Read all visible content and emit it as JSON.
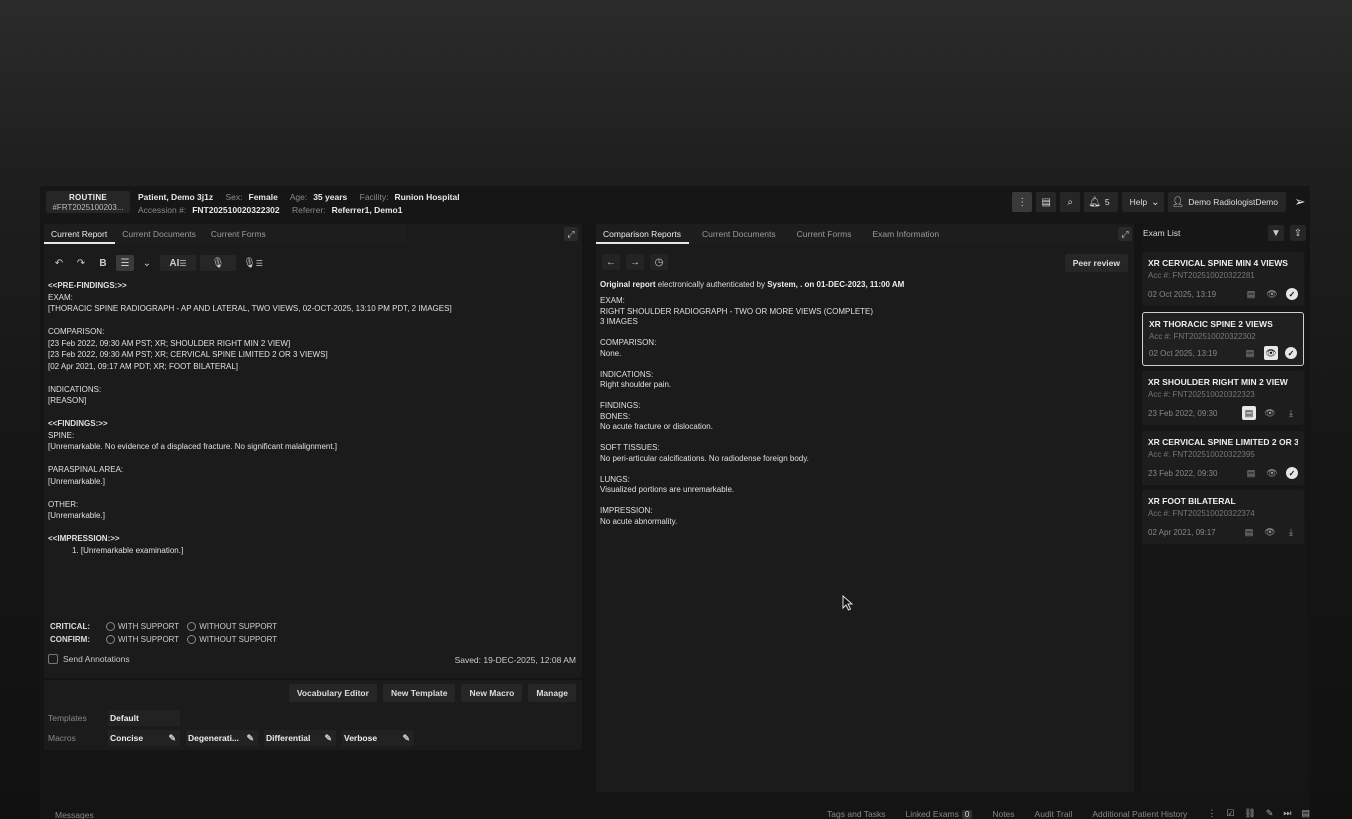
{
  "header": {
    "priority": "ROUTINE",
    "accession_short": "#FRT2025100203...",
    "patient_name": "Patient, Demo 3j1z",
    "sex_label": "Sex:",
    "sex": "Female",
    "age_label": "Age:",
    "age": "35 years",
    "facility_label": "Facility:",
    "facility": "Runion Hospital",
    "accession_label": "Accession #:",
    "accession": "FNT202510020322302",
    "referrer_label": "Referrer:",
    "referrer": "Referrer1, Demo1",
    "notifications_count": "5",
    "help_label": "Help",
    "user_name": "Demo RadiologistDemo"
  },
  "left_tabs": [
    "Current Report",
    "Current Documents",
    "Current Forms"
  ],
  "mid_tabs": [
    "Comparison Reports",
    "Current Documents",
    "Current Forms",
    "Exam Information"
  ],
  "toolbar": {
    "ai_label": "AI"
  },
  "report_lines": [
    {
      "t": "<<PRE-FINDINGS:>>",
      "b": true
    },
    {
      "t": "EXAM:"
    },
    {
      "t": "[THORACIC SPINE RADIOGRAPH - AP AND LATERAL, TWO VIEWS, 02-OCT-2025, 13:10 PM PDT, 2 IMAGES]"
    },
    {
      "t": ""
    },
    {
      "t": "COMPARISON:"
    },
    {
      "t": "[23 Feb 2022, 09:30 AM PST; XR; SHOULDER RIGHT MIN 2 VIEW]"
    },
    {
      "t": "[23 Feb 2022, 09:30 AM PST; XR; CERVICAL SPINE LIMITED 2 OR 3 VIEWS]"
    },
    {
      "t": "[02 Apr 2021, 09:17 AM PDT; XR; FOOT BILATERAL]"
    },
    {
      "t": ""
    },
    {
      "t": "INDICATIONS:"
    },
    {
      "t": "[REASON]"
    },
    {
      "t": ""
    },
    {
      "t": "<<FINDINGS:>>",
      "b": true
    },
    {
      "t": "SPINE:"
    },
    {
      "t": "[Unremarkable. No evidence of a displaced fracture. No significant malalignment.]"
    },
    {
      "t": ""
    },
    {
      "t": "PARASPINAL AREA:"
    },
    {
      "t": "[Unremarkable.]"
    },
    {
      "t": ""
    },
    {
      "t": "OTHER:"
    },
    {
      "t": "[Unremarkable.]"
    },
    {
      "t": ""
    },
    {
      "t": "<<IMPRESSION:>>",
      "b": true
    },
    {
      "t": "1. [Unremarkable examination.]",
      "i": true
    }
  ],
  "critical": {
    "critical_label": "CRITICAL:",
    "confirm_label": "CONFIRM:",
    "with_support": "WITH SUPPORT",
    "without_support": "WITHOUT SUPPORT"
  },
  "send_annotations": "Send Annotations",
  "saved": "Saved: 19-DEC-2025, 12:08 AM",
  "macro_buttons": [
    "Vocabulary Editor",
    "New Template",
    "New Macro",
    "Manage"
  ],
  "templates_label": "Templates",
  "template_value": "Default",
  "macros_label": "Macros",
  "macros": [
    "Concise",
    "Degenerati...",
    "Differential",
    "Verbose"
  ],
  "peer_review": "Peer review",
  "comparison": {
    "auth_prefix": "Original report",
    "auth_mid": " electronically authenticated by ",
    "auth_by": "System, . on 01-DEC-2023, 11:00 AM",
    "lines": [
      "EXAM:",
      "RIGHT SHOULDER RADIOGRAPH - TWO OR MORE VIEWS (COMPLETE)",
      "3 IMAGES",
      "",
      "COMPARISON:",
      "None.",
      "",
      "INDICATIONS:",
      "Right shoulder pain.",
      "",
      "FINDINGS:",
      "BONES:",
      "No acute fracture or dislocation.",
      "",
      "SOFT TISSUES:",
      "No peri-articular calcifications. No radiodense foreign body.",
      "",
      "LUNGS:",
      "Visualized portions are unremarkable.",
      "",
      "IMPRESSION:",
      "No acute abnormality."
    ]
  },
  "exam_list": {
    "title": "Exam List",
    "items": [
      {
        "title": "XR CERVICAL SPINE MIN 4 VIEWS",
        "acc": "Acc #: FNT202510020322281",
        "date": "02 Oct 2025, 13:19"
      },
      {
        "title": "XR THORACIC SPINE 2 VIEWS",
        "acc": "Acc #: FNT202510020322302",
        "date": "02 Oct 2025, 13:19"
      },
      {
        "title": "XR SHOULDER RIGHT MIN 2 VIEW",
        "acc": "Acc #: FNT202510020322323",
        "date": "23 Feb 2022, 09:30"
      },
      {
        "title": "XR CERVICAL SPINE LIMITED 2 OR 3 ...",
        "acc": "Acc #: FNT202510020322395",
        "date": "23 Feb 2022, 09:30"
      },
      {
        "title": "XR FOOT BILATERAL",
        "acc": "Acc #: FNT202510020322374",
        "date": "02 Apr 2021, 09:17"
      }
    ]
  },
  "footer": {
    "messages": "Messages",
    "tags": "Tags and Tasks",
    "linked": "Linked Exams",
    "linked_count": "0",
    "notes": "Notes",
    "audit": "Audit Trail",
    "history": "Additional Patient History"
  }
}
